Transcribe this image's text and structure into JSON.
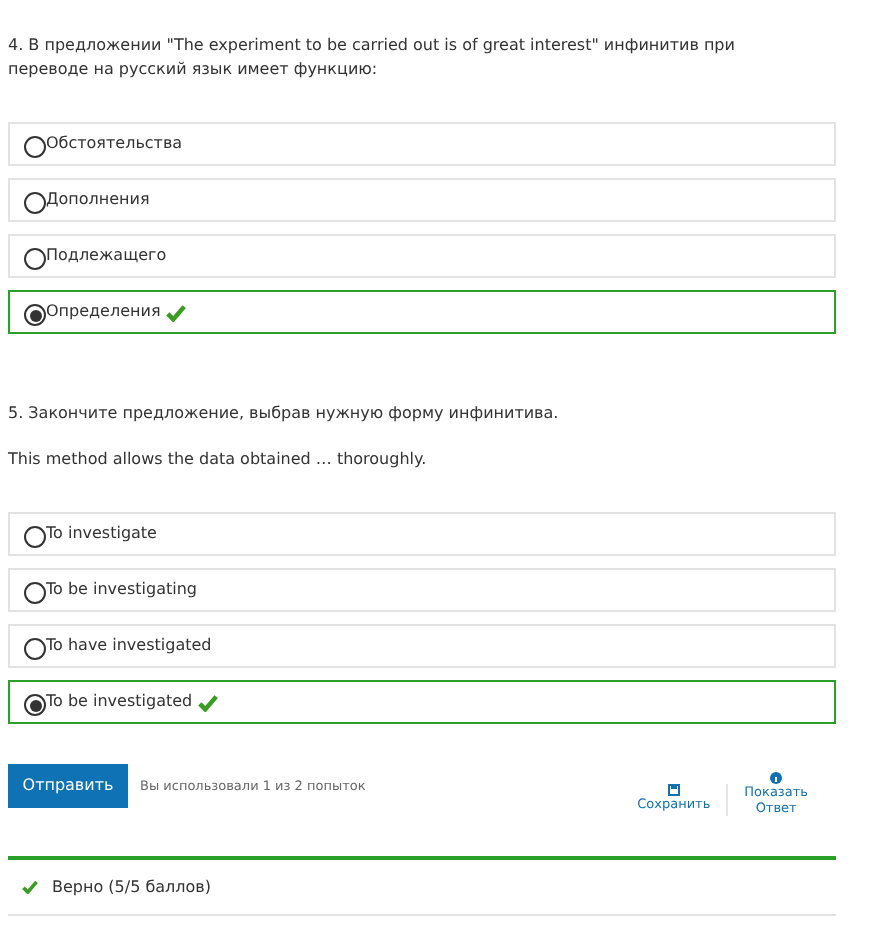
{
  "questions": [
    {
      "prompt": "4. В предложении \"The experiment to be carried out is of great interest\" инфинитив при переводе на русский язык имеет функцию:",
      "options": [
        {
          "label": "Обстоятельства",
          "selected": false,
          "correct": false
        },
        {
          "label": "Дополнения",
          "selected": false,
          "correct": false
        },
        {
          "label": "Подлежащего",
          "selected": false,
          "correct": false
        },
        {
          "label": "Определения",
          "selected": true,
          "correct": true
        }
      ]
    },
    {
      "prompt": "5. Закончите предложение, выбрав нужную форму инфинитива.",
      "sentence": "This method allows the data obtained … thoroughly.",
      "options": [
        {
          "label": "To investigate",
          "selected": false,
          "correct": false
        },
        {
          "label": "To be investigating",
          "selected": false,
          "correct": false
        },
        {
          "label": "To have investigated",
          "selected": false,
          "correct": false
        },
        {
          "label": "To be investigated",
          "selected": true,
          "correct": true
        }
      ]
    }
  ],
  "actions": {
    "submit": "Отправить",
    "attempts": "Вы использовали 1 из 2 попыток",
    "save": "Сохранить",
    "show_answer": [
      "Показать",
      "Ответ"
    ]
  },
  "result": {
    "correct": true,
    "text": "Верно (5/5 баллов)"
  }
}
